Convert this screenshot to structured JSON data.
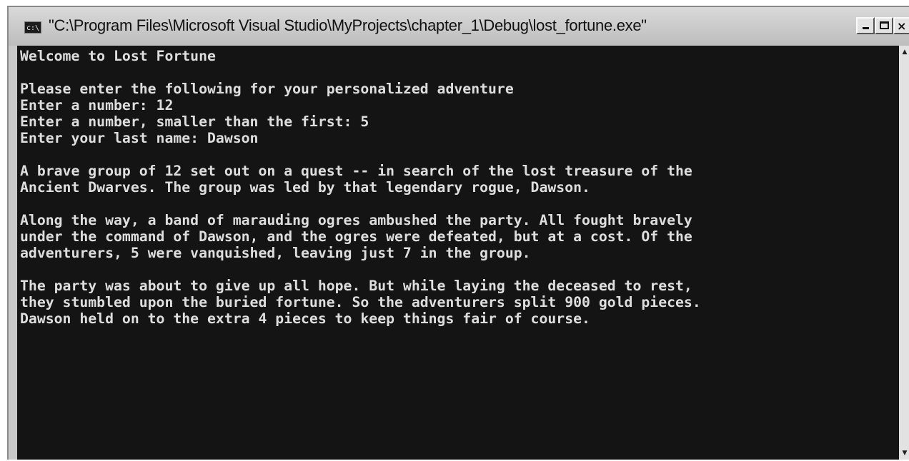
{
  "window": {
    "title": "\"C:\\Program Files\\Microsoft Visual Studio\\MyProjects\\chapter_1\\Debug\\lost_fortune.exe\"",
    "icon_label": "c:\\",
    "icon": "console-app-icon",
    "controls": [
      "minimize-icon",
      "maximize-icon",
      "close-icon"
    ]
  },
  "console": {
    "lines": [
      "Welcome to Lost Fortune",
      "",
      "Please enter the following for your personalized adventure",
      "Enter a number: 12",
      "Enter a number, smaller than the first: 5",
      "Enter your last name: Dawson",
      "",
      "A brave group of 12 set out on a quest -- in search of the lost treasure of the",
      "Ancient Dwarves. The group was led by that legendary rogue, Dawson.",
      "",
      "Along the way, a band of marauding ogres ambushed the party. All fought bravely",
      "under the command of Dawson, and the ogres were defeated, but at a cost. Of the",
      "adventurers, 5 were vanquished, leaving just 7 in the group.",
      "",
      "The party was about to give up all hope. But while laying the deceased to rest,",
      "they stumbled upon the buried fortune. So the adventurers split 900 gold pieces.",
      "Dawson held on to the extra 4 pieces to keep things fair of course."
    ]
  },
  "colors": {
    "console_bg": "#141414",
    "console_text": "#dedede",
    "chrome": "#c9c9c9"
  }
}
